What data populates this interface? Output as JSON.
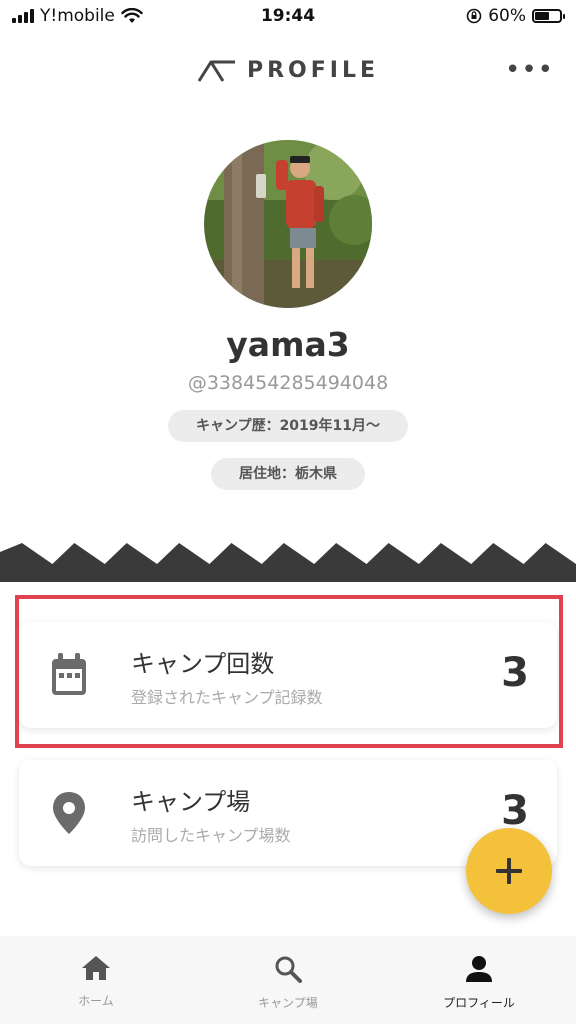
{
  "status_bar": {
    "carrier": "Y!mobile",
    "time": "19:44",
    "battery_percent": "60%",
    "battery_level": 0.6
  },
  "header": {
    "title": "PROFILE",
    "more_icon": "more-horizontal-icon"
  },
  "profile": {
    "name": "yama3",
    "handle": "@338454285494048",
    "camp_history": "キャンプ歴：2019年11月〜",
    "residence": "居住地：栃木県"
  },
  "stats": [
    {
      "icon": "calendar-icon",
      "title": "キャンプ回数",
      "subtitle": "登録されたキャンプ記録数",
      "count": "3"
    },
    {
      "icon": "location-pin-icon",
      "title": "キャンプ場",
      "subtitle": "訪問したキャンプ場数",
      "count": "3"
    }
  ],
  "fab": {
    "icon": "plus-icon"
  },
  "tabs": [
    {
      "icon": "home-icon",
      "label": "ホーム",
      "active": false
    },
    {
      "icon": "search-icon",
      "label": "キャンプ場",
      "active": false
    },
    {
      "icon": "person-icon",
      "label": "プロフィール",
      "active": true
    }
  ],
  "colors": {
    "highlight_border": "#e0434f",
    "fab": "#f4c23a",
    "zigzag": "#3a3a3a"
  }
}
